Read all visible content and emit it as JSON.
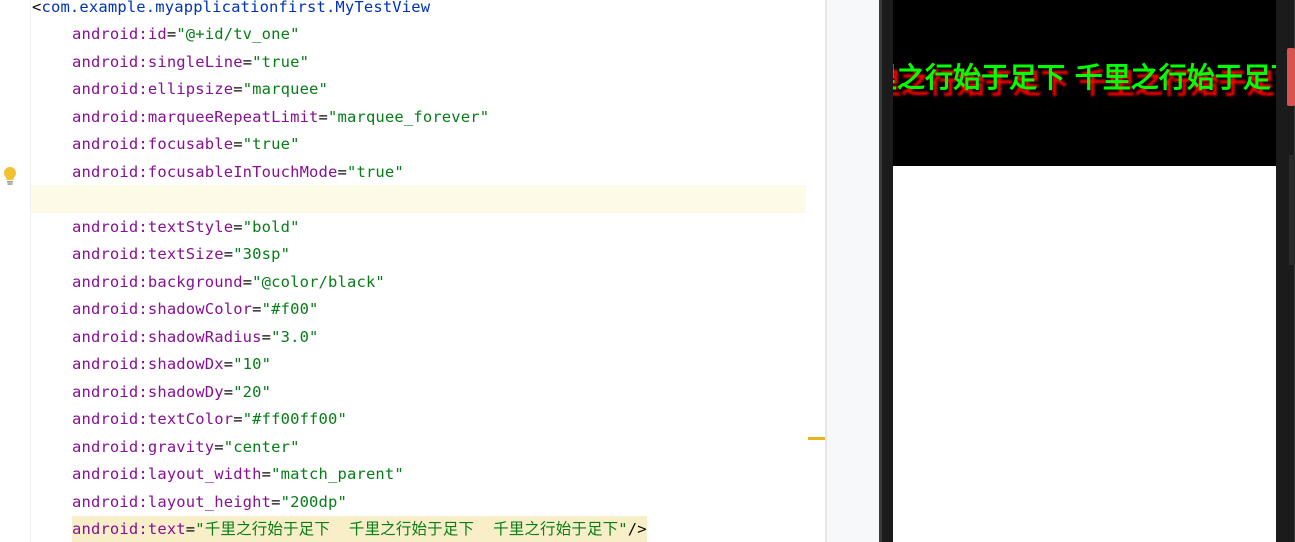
{
  "editor": {
    "open_tag": "<com.example.myapplicationfirst.MyTestView",
    "attributes": [
      {
        "name": "android:id",
        "value": "\"@+id/tv_one\""
      },
      {
        "name": "android:singleLine",
        "value": "\"true\""
      },
      {
        "name": "android:ellipsize",
        "value": "\"marquee\""
      },
      {
        "name": "android:marqueeRepeatLimit",
        "value": "\"marquee_forever\""
      },
      {
        "name": "android:focusable",
        "value": "\"true\""
      },
      {
        "name": "android:focusableInTouchMode",
        "value": "\"true\""
      },
      {
        "name": "android:textStyle",
        "value": "\"bold\""
      },
      {
        "name": "android:textSize",
        "value": "\"30sp\""
      },
      {
        "name": "android:background",
        "value": "\"@color/black\""
      },
      {
        "name": "android:shadowColor",
        "value": "\"#f00\""
      },
      {
        "name": "android:shadowRadius",
        "value": "\"3.0\""
      },
      {
        "name": "android:shadowDx",
        "value": "\"10\""
      },
      {
        "name": "android:shadowDy",
        "value": "\"20\""
      },
      {
        "name": "android:textColor",
        "value": "\"#ff00ff00\""
      },
      {
        "name": "android:gravity",
        "value": "\"center\""
      },
      {
        "name": "android:layout_width",
        "value": "\"match_parent\""
      },
      {
        "name": "android:layout_height",
        "value": "\"200dp\""
      },
      {
        "name": "android:text",
        "value": "\"千里之行始于足下  千里之行始于足下  千里之行始于足下\""
      }
    ],
    "close_tag": "/>"
  },
  "preview": {
    "marquee_text": "千里之行始于足下  千里之行始于足下",
    "text_color": "#00ff00",
    "shadow_color": "#ff0000",
    "background_color": "#000000"
  },
  "colors": {
    "attr_name": "#871094",
    "attr_value": "#067d17",
    "tag": "#0033b3",
    "caret_line": "#fdfae8"
  }
}
